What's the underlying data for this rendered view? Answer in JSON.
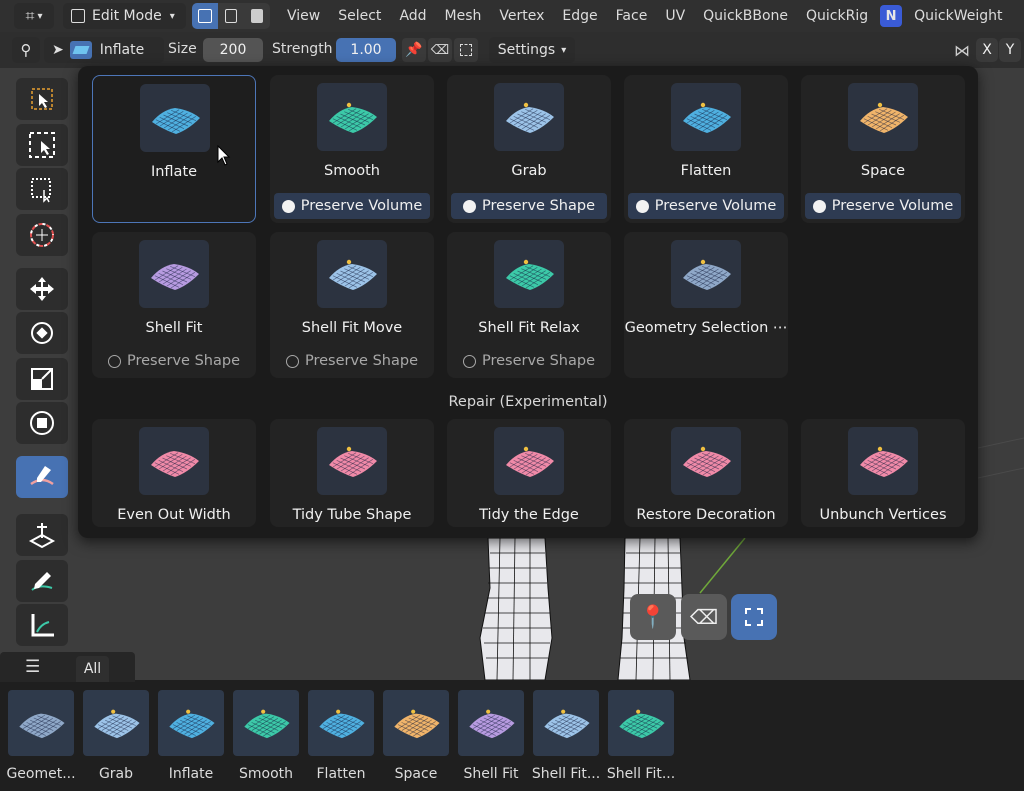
{
  "header": {
    "editor_icon": "editor-type-icon",
    "mode": "Edit Mode",
    "menus": [
      "View",
      "Select",
      "Add",
      "Mesh",
      "Vertex",
      "Edge",
      "Face",
      "UV",
      "QuickBBone",
      "QuickRig",
      "QuickWeight"
    ],
    "addon_badge": "N"
  },
  "tool_header": {
    "active_tool": "Inflate",
    "size_label": "Size",
    "size_value": "200",
    "strength_label": "Strength",
    "strength_value": "1.00",
    "settings_label": "Settings",
    "axis_x": "X",
    "axis_y": "Y"
  },
  "popup": {
    "row1": [
      {
        "label": "Inflate",
        "option": "",
        "option_on": null,
        "color": "#4fb0e0",
        "selected": true
      },
      {
        "label": "Smooth",
        "option": "Preserve Volume",
        "option_on": true,
        "color": "#3cc9a8"
      },
      {
        "label": "Grab",
        "option": "Preserve Shape",
        "option_on": true,
        "color": "#9cc3e8"
      },
      {
        "label": "Flatten",
        "option": "Preserve Volume",
        "option_on": true,
        "color": "#4fb0e0"
      },
      {
        "label": "Space",
        "option": "Preserve Volume",
        "option_on": true,
        "color": "#f0b46a"
      }
    ],
    "row2": [
      {
        "label": "Shell Fit",
        "option": "Preserve Shape",
        "option_on": false,
        "color": "#b79be0"
      },
      {
        "label": "Shell Fit Move",
        "option": "Preserve Shape",
        "option_on": false,
        "color": "#9cc3e8"
      },
      {
        "label": "Shell Fit Relax",
        "option": "Preserve Shape",
        "option_on": false,
        "color": "#3cc9a8"
      },
      {
        "label": "Geometry Selection ⋯",
        "option": "",
        "option_on": null,
        "color": "#8fa8c8"
      }
    ],
    "section_title": "Repair (Experimental)",
    "row3": [
      {
        "label": "Even Out Width",
        "color": "#f08aa8"
      },
      {
        "label": "Tidy Tube Shape",
        "color": "#f08aa8"
      },
      {
        "label": "Tidy the Edge",
        "color": "#f08aa8"
      },
      {
        "label": "Restore Decoration",
        "color": "#f08aa8"
      },
      {
        "label": "Unbunch Vertices",
        "color": "#f08aa8"
      }
    ]
  },
  "shelf": {
    "menu_icon": "hamburger-icon",
    "tab": "All",
    "items": [
      {
        "label": "Geomet...",
        "color": "#8fa8c8"
      },
      {
        "label": "Grab",
        "color": "#9cc3e8"
      },
      {
        "label": "Inflate",
        "color": "#4fb0e0"
      },
      {
        "label": "Smooth",
        "color": "#3cc9a8"
      },
      {
        "label": "Flatten",
        "color": "#4fb0e0"
      },
      {
        "label": "Space",
        "color": "#f0b46a"
      },
      {
        "label": "Shell Fit",
        "color": "#b79be0"
      },
      {
        "label": "Shell Fit...",
        "color": "#9cc3e8"
      },
      {
        "label": "Shell Fit...",
        "color": "#3cc9a8"
      }
    ]
  },
  "colors": {
    "accent": "#4772b3",
    "panel": "#1b1b1b",
    "option_bg": "#2e3b52"
  }
}
